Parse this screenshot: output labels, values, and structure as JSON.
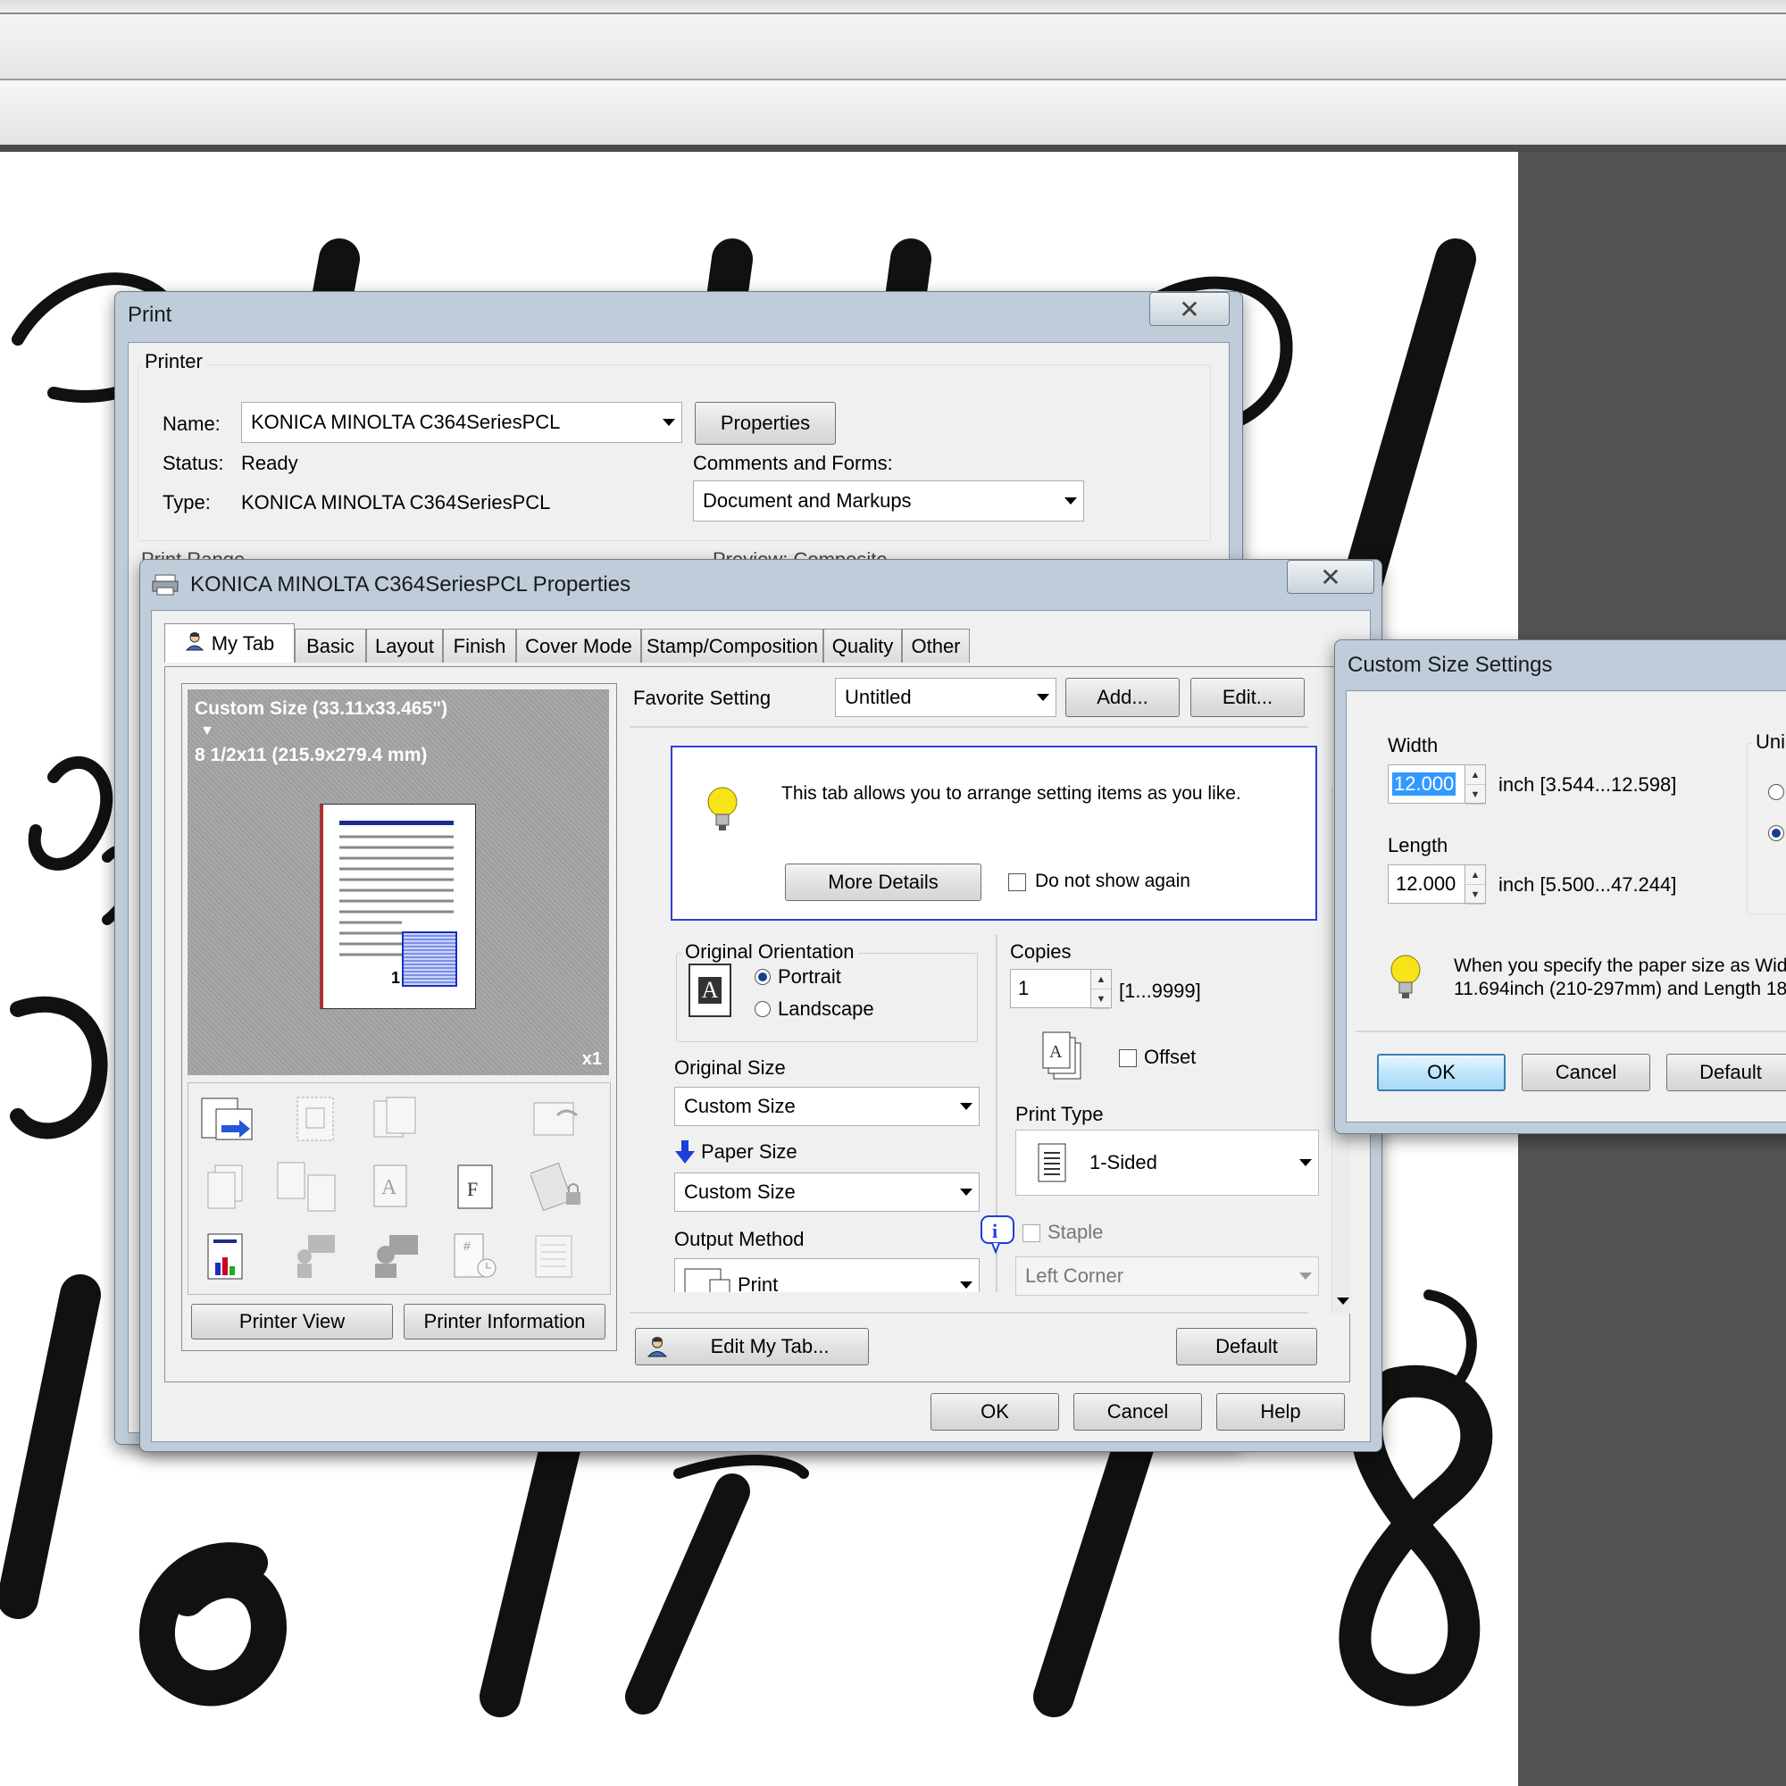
{
  "print_dialog": {
    "title": "Print",
    "close_glyph": "✕",
    "printer_group": "Printer",
    "name_label": "Name:",
    "name_value": "KONICA MINOLTA C364SeriesPCL",
    "properties_button": "Properties",
    "status_label": "Status:",
    "status_value": "Ready",
    "type_label": "Type:",
    "type_value": "KONICA MINOLTA C364SeriesPCL",
    "comments_label": "Comments and Forms:",
    "comments_value": "Document and Markups",
    "print_range_partial": "Print Range",
    "preview_partial": "Preview: Composite"
  },
  "properties_dialog": {
    "title": "KONICA MINOLTA C364SeriesPCL Properties",
    "close_glyph": "✕",
    "tabs": [
      "My Tab",
      "Basic",
      "Layout",
      "Finish",
      "Cover Mode",
      "Stamp/Composition",
      "Quality",
      "Other"
    ],
    "preview": {
      "line1": "Custom Size (33.11x33.465\")",
      "arrow": "▼",
      "line2": "8 1/2x11 (215.9x279.4 mm)",
      "page_number": "1",
      "copies_badge": "x1"
    },
    "printer_view_button": "Printer View",
    "printer_info_button": "Printer Information",
    "favorite_label": "Favorite Setting",
    "favorite_value": "Untitled",
    "add_button": "Add...",
    "edit_button": "Edit...",
    "tip_text": "This tab allows you to arrange setting items as you like.",
    "more_details_button": "More Details",
    "do_not_show_label": "Do not show again",
    "orientation_group": "Original Orientation",
    "portrait_label": "Portrait",
    "landscape_label": "Landscape",
    "orientation_glyph": "A",
    "original_size_label": "Original Size",
    "original_size_value": "Custom Size",
    "paper_size_label": "Paper Size",
    "paper_size_value": "Custom Size",
    "output_method_label": "Output Method",
    "output_method_value": "Print",
    "copies_label": "Copies",
    "copies_value": "1",
    "copies_range": "[1...9999]",
    "offset_label": "Offset",
    "print_type_label": "Print Type",
    "print_type_value": "1-Sided",
    "staple_label": "Staple",
    "staple_value": "Left Corner",
    "edit_my_tab_button": "Edit My Tab...",
    "default_button": "Default",
    "ok_button": "OK",
    "cancel_button": "Cancel",
    "help_button": "Help"
  },
  "custom_size_dialog": {
    "title": "Custom Size Settings",
    "width_label": "Width",
    "width_value": "12.000",
    "width_range": "inch [3.544...12.598]",
    "length_label": "Length",
    "length_value": "12.000",
    "length_range": "inch [5.500...47.244]",
    "unit_partial": "Uni",
    "tip_line1": "When you specify the paper size as Wid",
    "tip_line2": "11.694inch (210-297mm) and Length 18",
    "ok_button": "OK",
    "cancel_button": "Cancel",
    "default_button": "Default"
  },
  "colors": {
    "window_frame": "#bfcddb",
    "client": "#f0f0f0",
    "highlight": "#3399ff",
    "dark_canvas": "#535353"
  }
}
